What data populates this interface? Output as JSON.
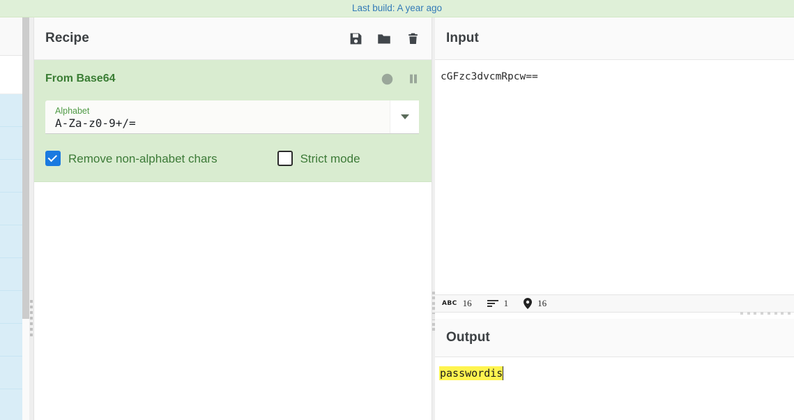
{
  "banner": {
    "text": "Last build: A year ago",
    "link_color": "#337ab7",
    "bg_color": "#dff0d8"
  },
  "operations_sidebar": {
    "visible_rows": 9,
    "row_color": "#d9edf7"
  },
  "recipe": {
    "title": "Recipe",
    "icons": [
      {
        "name": "save-icon",
        "label": "Save recipe"
      },
      {
        "name": "folder-icon",
        "label": "Load recipe"
      },
      {
        "name": "trash-icon",
        "label": "Clear recipe"
      }
    ],
    "operation": {
      "name": "From Base64",
      "name_color": "#3a7d34",
      "bg_color": "#d9ecd0",
      "head_icons": [
        {
          "name": "disable-icon",
          "label": "Disable operation"
        },
        {
          "name": "pause-icon",
          "label": "Set breakpoint"
        }
      ],
      "argument": {
        "label": "Alphabet",
        "value": "A-Za-z0-9+/=",
        "has_dropdown": true
      },
      "checkboxes": [
        {
          "label": "Remove non-alphabet chars",
          "checked": true
        },
        {
          "label": "Strict mode",
          "checked": false
        }
      ]
    }
  },
  "input": {
    "title": "Input",
    "value": "cGFzc3dvcmRpcw==",
    "status": {
      "length_icon": "abc-icon",
      "length_label": "ABC",
      "length": "16",
      "lines_icon": "lines-icon",
      "lines": "1",
      "position_icon": "map-pin-icon",
      "position": "16"
    }
  },
  "output": {
    "title": "Output",
    "value": "passwordis",
    "highlight_color": "#fff44f"
  }
}
